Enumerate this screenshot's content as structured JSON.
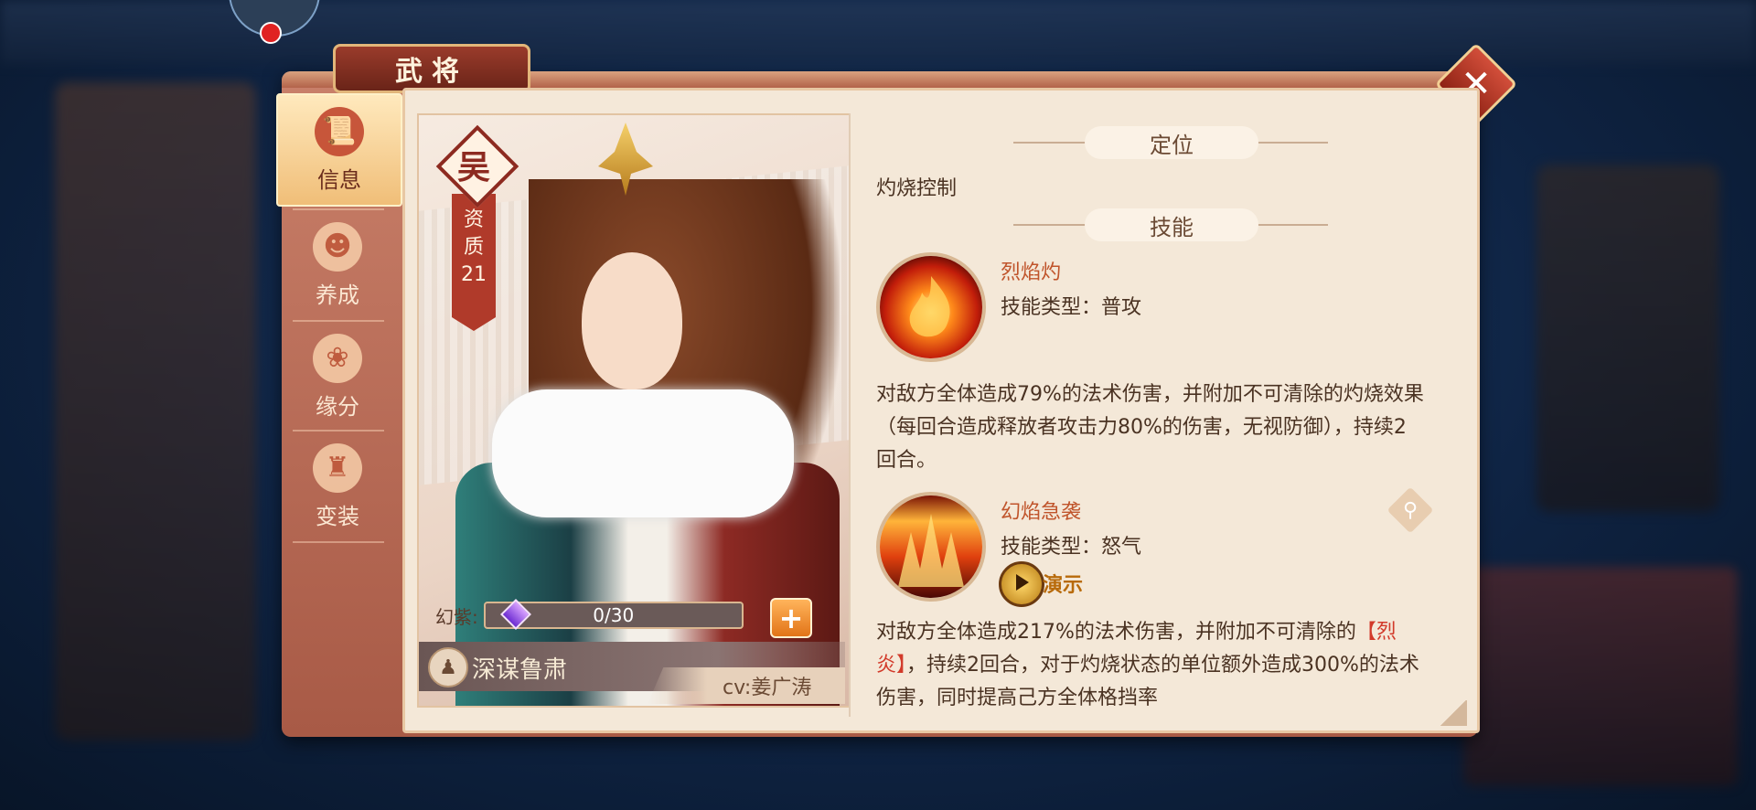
{
  "window": {
    "title": "武将"
  },
  "tabs": [
    {
      "label": "信息",
      "icon": "scroll-icon",
      "active": true
    },
    {
      "label": "养成",
      "icon": "silhouette-icon",
      "active": false
    },
    {
      "label": "缘分",
      "icon": "bond-icon",
      "active": false
    },
    {
      "label": "变装",
      "icon": "outfit-icon",
      "active": false
    }
  ],
  "hero": {
    "faction": "吴",
    "aptitude_label": "资质",
    "aptitude_value": "21",
    "fragment_label": "幻紫:",
    "fragment_progress": "0/30",
    "fragment_fraction": 0,
    "skill_title": "深谋鲁肃",
    "cv": "cv:姜广涛"
  },
  "info": {
    "position_heading": "定位",
    "position_text": "灼烧控制",
    "skills_heading": "技能",
    "skills": [
      {
        "name": "烈焰灼",
        "type": "技能类型：普攻",
        "desc_before": "对敌方全体造成79%的法术伤害，并附加不可清除的灼烧效果（每回合造成释放者攻击力80%的伤害，无视防御），持续2回合。",
        "desc_keyword": "",
        "desc_after": ""
      },
      {
        "name": "幻焰急袭",
        "type": "技能类型：怒气",
        "demo_label": "演示",
        "desc_before": "对敌方全体造成217%的法术伤害，并附加不可清除的",
        "desc_keyword": "【烈炎】",
        "desc_after": "，持续2回合，对于灼烧状态的单位额外造成300%的法术伤害，同时提高己方全体格挡率"
      }
    ]
  },
  "colors": {
    "accent": "#a85a46",
    "paper": "#f4e8d8",
    "keyword": "#d23a2a",
    "skill_name": "#c0542b"
  }
}
